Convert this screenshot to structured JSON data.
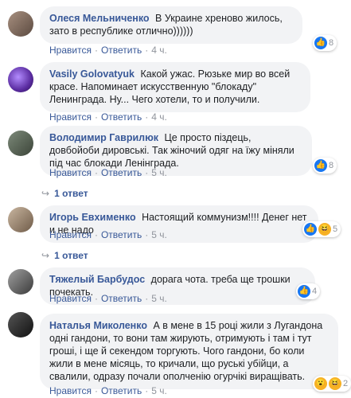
{
  "comments": [
    {
      "author": "Олеся Мельниченко",
      "text": "В Украине хреново жилось, зато в республике отлично))))))",
      "like_label": "Нравится",
      "reply_label": "Ответить",
      "time": "4 ч.",
      "reaction_count": "8",
      "reactions": [
        "like-icon"
      ]
    },
    {
      "author": "Vasily Golovatyuk",
      "text": "Какой ужас. Рюзьке мир во всей красе. Напоминает искусственную \"блокаду\" Ленинграда. Ну... Чего хотели, то и получили.",
      "like_label": "Нравится",
      "reply_label": "Ответить",
      "time": "4 ч."
    },
    {
      "author": "Володимир Гаврилюк",
      "text": "Це просто піздець, довбойоби дировські. Так жіночий одяг на їжу міняли під час блокади Ленінграда.",
      "like_label": "Нравится",
      "reply_label": "Ответить",
      "time": "5 ч.",
      "reaction_count": "8",
      "reactions": [
        "like-icon"
      ],
      "replies_label": "1 ответ"
    },
    {
      "author": "Игорь Евхименко",
      "text": "Настоящий коммунизм!!!! Денег нет и не надо",
      "like_label": "Нравится",
      "reply_label": "Ответить",
      "time": "5 ч.",
      "reaction_count": "5",
      "reactions": [
        "like-icon",
        "haha-icon"
      ],
      "replies_label": "1 ответ"
    },
    {
      "author": "Тяжелый Барбудос",
      "text": "дорага чота. треба ще трошки почекать.",
      "like_label": "Нравится",
      "reply_label": "Ответить",
      "time": "5 ч.",
      "reaction_count": "4",
      "reactions": [
        "like-icon"
      ]
    },
    {
      "author": "Наталья Миколенко",
      "text": "А в мене в 15 році жили з Лугандона одні гандони, то вони там жирують, отримують і там і тут гроші, і ще й секендом торгують. Чого гандони, бо коли жили в мене місяць, то кричали, що руські убійци, а свалили, одразу почали ополченію огурчікі вирaщівать.",
      "like_label": "Нравится",
      "reply_label": "Ответить",
      "time": "5 ч.",
      "reaction_count": "2",
      "reactions": [
        "wow-icon",
        "haha-icon"
      ]
    }
  ]
}
